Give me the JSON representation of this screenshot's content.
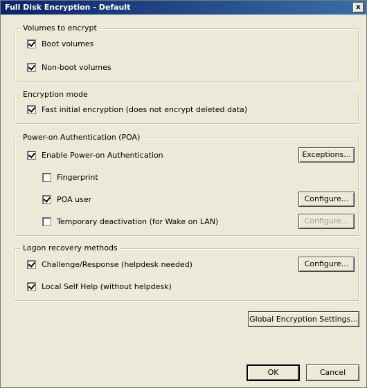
{
  "window": {
    "title": "Full Disk Encryption - Default",
    "close_glyph": "x"
  },
  "volumes": {
    "legend": "Volumes to encrypt",
    "boot": {
      "label": "Boot volumes",
      "checked": true
    },
    "nonboot": {
      "label": "Non-boot volumes",
      "checked": true
    }
  },
  "mode": {
    "legend": "Encryption mode",
    "fast": {
      "label": "Fast initial encryption (does not encrypt deleted data)",
      "checked": true
    }
  },
  "poa": {
    "legend": "Power-on Authentication (POA)",
    "enable": {
      "label": "Enable Power-on Authentication",
      "checked": true
    },
    "exceptions_button": "Exceptions...",
    "fingerprint": {
      "label": "Fingerprint",
      "checked": false
    },
    "poa_user": {
      "label": "POA user",
      "checked": true
    },
    "poa_user_configure": "Configure...",
    "temp_deactivation": {
      "label": "Temporary deactivation (for Wake on LAN)",
      "checked": false
    },
    "temp_configure": "Configure..."
  },
  "recovery": {
    "legend": "Logon recovery methods",
    "challenge": {
      "label": "Challenge/Response (helpdesk needed)",
      "checked": true
    },
    "challenge_configure": "Configure...",
    "selfhelp": {
      "label": "Local Self Help (without helpdesk)",
      "checked": true
    }
  },
  "buttons": {
    "global_settings": "Global Encryption Settings...",
    "ok": "OK",
    "cancel": "Cancel"
  }
}
